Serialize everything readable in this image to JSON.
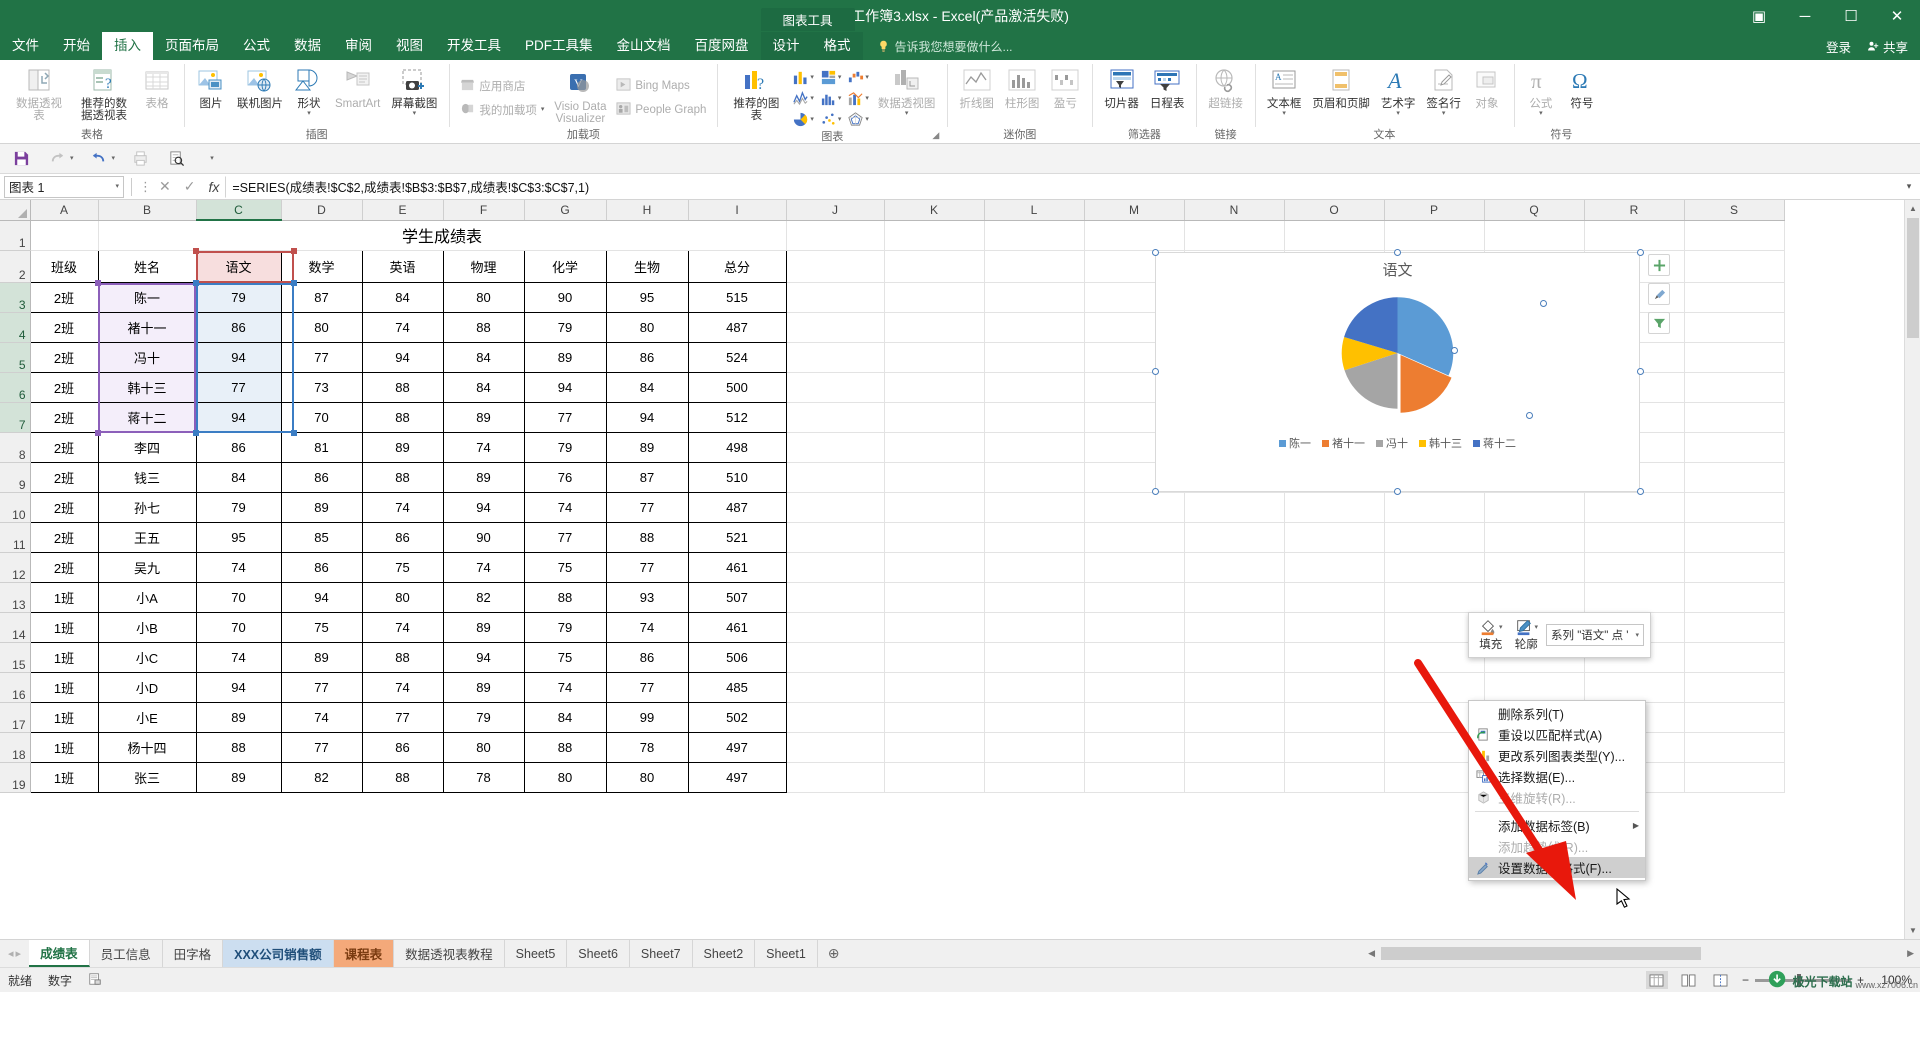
{
  "titlebar": {
    "title": "工作簿3.xlsx - Excel(产品激活失败)",
    "restore_icon": "▣",
    "minimize_icon": "─",
    "maximize_icon": "☐",
    "close_icon": "✕",
    "ribbon_display_icon": "⌃"
  },
  "tabs": [
    {
      "label": "文件",
      "active": false
    },
    {
      "label": "开始",
      "active": false
    },
    {
      "label": "插入",
      "active": true
    },
    {
      "label": "页面布局",
      "active": false
    },
    {
      "label": "公式",
      "active": false
    },
    {
      "label": "数据",
      "active": false
    },
    {
      "label": "审阅",
      "active": false
    },
    {
      "label": "视图",
      "active": false
    },
    {
      "label": "开发工具",
      "active": false
    },
    {
      "label": "PDF工具集",
      "active": false
    },
    {
      "label": "金山文档",
      "active": false
    },
    {
      "label": "百度网盘",
      "active": false
    }
  ],
  "contextual": {
    "group_title": "图表工具",
    "tabs": [
      {
        "label": "设计",
        "active": false
      },
      {
        "label": "格式",
        "active": false
      }
    ]
  },
  "tellme": {
    "placeholder": "告诉我您想要做什么..."
  },
  "account": {
    "signin": "登录",
    "share": "共享"
  },
  "ribbon": {
    "groups": [
      {
        "name": "表格",
        "label": "表格",
        "items": [
          {
            "label": "数据透视表",
            "icon": "pivot-table-icon",
            "disabled": true,
            "two_line": true
          },
          {
            "label": "推荐的数据透视表",
            "icon": "recommended-pivot-icon",
            "disabled": false,
            "two_line": true
          },
          {
            "label": "表格",
            "icon": "table-icon",
            "disabled": true,
            "two_line": false
          }
        ]
      },
      {
        "name": "插图",
        "label": "插图",
        "items": [
          {
            "label": "图片",
            "icon": "picture-icon",
            "disabled": false
          },
          {
            "label": "联机图片",
            "icon": "online-picture-icon",
            "disabled": false
          },
          {
            "label": "形状",
            "icon": "shapes-icon",
            "disabled": false,
            "caret": true
          },
          {
            "label": "SmartArt",
            "icon": "smartart-icon",
            "disabled": true
          },
          {
            "label": "屏幕截图",
            "icon": "screenshot-icon",
            "disabled": false,
            "caret": true
          }
        ]
      },
      {
        "name": "加载项",
        "label": "加载项",
        "small_items": [
          {
            "label": "应用商店",
            "icon": "store-icon",
            "disabled": true
          },
          {
            "label": "我的加载项",
            "icon": "my-addins-icon",
            "disabled": true,
            "caret": true
          },
          {
            "label": "Bing Maps",
            "icon": "bing-maps-icon",
            "disabled": true
          },
          {
            "label": "People Graph",
            "icon": "people-graph-icon",
            "disabled": true
          }
        ],
        "big_items": [
          {
            "label": "Visio Data Visualizer",
            "icon": "visio-data-visualizer-icon",
            "disabled": true
          }
        ]
      },
      {
        "name": "图表",
        "label": "图表",
        "recommended": {
          "label": "推荐的图表",
          "icon": "recommended-charts-icon"
        },
        "mini": [
          {
            "icon": "column-chart-icon"
          },
          {
            "icon": "hierarchy-chart-icon"
          },
          {
            "icon": "waterfall-chart-icon"
          },
          {
            "icon": "line-chart-icon"
          },
          {
            "icon": "statistic-chart-icon"
          },
          {
            "icon": "combo-chart-icon"
          },
          {
            "icon": "pie-chart-icon"
          },
          {
            "icon": "scatter-chart-icon"
          },
          {
            "icon": "radar-chart-icon"
          }
        ],
        "pivotchart": {
          "label": "数据透视图",
          "icon": "pivot-chart-icon",
          "disabled": true,
          "caret": true
        },
        "has_launcher": true
      },
      {
        "name": "迷你图",
        "label": "迷你图",
        "items": [
          {
            "label": "折线图",
            "icon": "sparkline-line-icon",
            "disabled": true
          },
          {
            "label": "柱形图",
            "icon": "sparkline-column-icon",
            "disabled": true
          },
          {
            "label": "盈亏",
            "icon": "sparkline-winloss-icon",
            "disabled": true
          }
        ]
      },
      {
        "name": "筛选器",
        "label": "筛选器",
        "items": [
          {
            "label": "切片器",
            "icon": "slicer-icon",
            "disabled": false
          },
          {
            "label": "日程表",
            "icon": "timeline-icon",
            "disabled": false
          }
        ]
      },
      {
        "name": "链接",
        "label": "链接",
        "items": [
          {
            "label": "超链接",
            "icon": "hyperlink-icon",
            "disabled": true
          }
        ]
      },
      {
        "name": "文本",
        "label": "文本",
        "items": [
          {
            "label": "文本框",
            "icon": "textbox-icon",
            "disabled": false,
            "caret": true
          },
          {
            "label": "页眉和页脚",
            "icon": "header-footer-icon",
            "disabled": false
          },
          {
            "label": "艺术字",
            "icon": "wordart-icon",
            "disabled": false,
            "caret": true
          },
          {
            "label": "签名行",
            "icon": "signature-line-icon",
            "disabled": false,
            "caret": true
          },
          {
            "label": "对象",
            "icon": "object-icon",
            "disabled": true
          }
        ]
      },
      {
        "name": "符号",
        "label": "符号",
        "items": [
          {
            "label": "公式",
            "icon": "equation-icon",
            "disabled": true,
            "caret": true
          },
          {
            "label": "符号",
            "icon": "symbol-icon",
            "disabled": false
          }
        ]
      }
    ]
  },
  "qat": {
    "buttons": [
      {
        "name": "save-button",
        "icon": "save-icon",
        "disabled": false
      },
      {
        "name": "redo-button",
        "icon": "redo-icon",
        "disabled": true
      },
      {
        "name": "undo-button",
        "icon": "undo-icon",
        "disabled": false
      },
      {
        "name": "quick-print-button",
        "icon": "quick-print-icon",
        "disabled": true
      },
      {
        "name": "print-preview-button",
        "icon": "print-preview-icon",
        "disabled": false
      },
      {
        "name": "customize-qat-button",
        "icon": "chevron-down-icon",
        "disabled": true
      }
    ]
  },
  "formulabar": {
    "namebox_value": "图表 1",
    "namebox_caret": "▾",
    "cancel_icon": "✕",
    "enter_icon": "✓",
    "fx_icon": "fx",
    "formula": "=SERIES(成绩表!$C$2,成绩表!$B$3:$B$7,成绩表!$C$3:$C$7,1)",
    "expand_icon": "▾"
  },
  "grid": {
    "columns": [
      "A",
      "B",
      "C",
      "D",
      "E",
      "F",
      "G",
      "H",
      "I",
      "J",
      "K",
      "L",
      "M",
      "N",
      "O",
      "P",
      "Q",
      "R",
      "S"
    ],
    "selected_column": "C",
    "rows": [
      1,
      2,
      3,
      4,
      5,
      6,
      7,
      8,
      9,
      10,
      11,
      12,
      13,
      14,
      15,
      16,
      17,
      18,
      19
    ],
    "selected_rows": [
      3,
      4,
      5,
      6,
      7
    ],
    "title_row": {
      "row": 1,
      "text": "学生成绩表"
    },
    "headers": [
      "班级",
      "姓名",
      "语文",
      "数学",
      "英语",
      "物理",
      "化学",
      "生物",
      "总分"
    ],
    "data": [
      {
        "row": 3,
        "cells": [
          "2班",
          "陈一",
          "79",
          "87",
          "84",
          "80",
          "90",
          "95",
          "515"
        ]
      },
      {
        "row": 4,
        "cells": [
          "2班",
          "褚十一",
          "86",
          "80",
          "74",
          "88",
          "79",
          "80",
          "487"
        ]
      },
      {
        "row": 5,
        "cells": [
          "2班",
          "冯十",
          "94",
          "77",
          "94",
          "84",
          "89",
          "86",
          "524"
        ]
      },
      {
        "row": 6,
        "cells": [
          "2班",
          "韩十三",
          "77",
          "73",
          "88",
          "84",
          "94",
          "84",
          "500"
        ]
      },
      {
        "row": 7,
        "cells": [
          "2班",
          "蒋十二",
          "94",
          "70",
          "88",
          "89",
          "77",
          "94",
          "512"
        ]
      },
      {
        "row": 8,
        "cells": [
          "2班",
          "李四",
          "86",
          "81",
          "89",
          "74",
          "79",
          "89",
          "498"
        ]
      },
      {
        "row": 9,
        "cells": [
          "2班",
          "钱三",
          "84",
          "86",
          "88",
          "89",
          "76",
          "87",
          "510"
        ]
      },
      {
        "row": 10,
        "cells": [
          "2班",
          "孙七",
          "79",
          "89",
          "74",
          "94",
          "74",
          "77",
          "487"
        ]
      },
      {
        "row": 11,
        "cells": [
          "2班",
          "王五",
          "95",
          "85",
          "86",
          "90",
          "77",
          "88",
          "521"
        ]
      },
      {
        "row": 12,
        "cells": [
          "2班",
          "吴九",
          "74",
          "86",
          "75",
          "74",
          "75",
          "77",
          "461"
        ]
      },
      {
        "row": 13,
        "cells": [
          "1班",
          "小A",
          "70",
          "94",
          "80",
          "82",
          "88",
          "93",
          "507"
        ]
      },
      {
        "row": 14,
        "cells": [
          "1班",
          "小B",
          "70",
          "75",
          "74",
          "89",
          "79",
          "74",
          "461"
        ]
      },
      {
        "row": 15,
        "cells": [
          "1班",
          "小C",
          "74",
          "89",
          "88",
          "94",
          "75",
          "86",
          "506"
        ]
      },
      {
        "row": 16,
        "cells": [
          "1班",
          "小D",
          "94",
          "77",
          "74",
          "89",
          "74",
          "77",
          "485"
        ]
      },
      {
        "row": 17,
        "cells": [
          "1班",
          "小E",
          "89",
          "74",
          "77",
          "79",
          "84",
          "99",
          "502"
        ]
      },
      {
        "row": 18,
        "cells": [
          "1班",
          "杨十四",
          "88",
          "77",
          "86",
          "80",
          "88",
          "78",
          "497"
        ]
      },
      {
        "row": 19,
        "cells": [
          "1班",
          "张三",
          "89",
          "82",
          "88",
          "78",
          "80",
          "80",
          "497"
        ]
      }
    ]
  },
  "chart_data": {
    "type": "pie",
    "title": "语文",
    "categories": [
      "陈一",
      "褚十一",
      "冯十",
      "韩十三",
      "蒋十二"
    ],
    "values": [
      79,
      86,
      94,
      77,
      94
    ],
    "colors": [
      "#5b9bd5",
      "#ed7d31",
      "#a5a5a5",
      "#ffc000",
      "#4472c4"
    ],
    "legend_position": "bottom",
    "legend_entries": [
      "陈一",
      "褚十一",
      "冯十",
      "韩十三",
      "蒋十二"
    ],
    "xlabel": "",
    "ylabel": "",
    "selected_point": "褚十一"
  },
  "chart_sidebuttons": [
    {
      "name": "chart-elements-button",
      "icon": "plus-icon"
    },
    {
      "name": "chart-styles-button",
      "icon": "brush-icon"
    },
    {
      "name": "chart-filters-button",
      "icon": "filter-icon"
    }
  ],
  "minitoolbar": {
    "fill": {
      "label": "填充",
      "icon": "fill-bucket-icon",
      "caret": "▾"
    },
    "outline": {
      "label": "轮廓",
      "icon": "outline-pen-icon",
      "caret": "▾"
    },
    "combo_value": "系列 \"语文\" 点 '",
    "combo_caret": "▾"
  },
  "contextmenu": {
    "items": [
      {
        "label": "删除系列(T)",
        "icon": "",
        "disabled": false,
        "highlight": false,
        "submenu": false
      },
      {
        "label": "重设以匹配样式(A)",
        "icon": "reset-style-icon",
        "disabled": false,
        "highlight": false,
        "submenu": false
      },
      {
        "label": "更改系列图表类型(Y)...",
        "icon": "change-chart-type-icon",
        "disabled": false,
        "highlight": false,
        "submenu": false
      },
      {
        "label": "选择数据(E)...",
        "icon": "select-data-icon",
        "disabled": false,
        "highlight": false,
        "submenu": false
      },
      {
        "label": "三维旋转(R)...",
        "icon": "3d-rotation-icon",
        "disabled": true,
        "highlight": false,
        "submenu": false
      },
      {
        "separator": true
      },
      {
        "label": "添加数据标签(B)",
        "icon": "",
        "disabled": false,
        "highlight": false,
        "submenu": true
      },
      {
        "label": "添加趋势线(R)...",
        "icon": "",
        "disabled": true,
        "highlight": false,
        "submenu": false
      },
      {
        "label": "设置数据点格式(F)...",
        "icon": "format-datapoint-icon",
        "disabled": false,
        "highlight": true,
        "submenu": false
      }
    ]
  },
  "sheettabs": {
    "nav": {
      "prev": "◂",
      "next": "▸"
    },
    "tabs": [
      {
        "label": "成绩表",
        "active": true,
        "color": ""
      },
      {
        "label": "员工信息",
        "active": false,
        "color": ""
      },
      {
        "label": "田字格",
        "active": false,
        "color": ""
      },
      {
        "label": "XXX公司销售额",
        "active": false,
        "color": "#ccdef0"
      },
      {
        "label": "课程表",
        "active": false,
        "color": "#f4a97a"
      },
      {
        "label": "数据透视表教程",
        "active": false,
        "color": ""
      },
      {
        "label": "Sheet5",
        "active": false,
        "color": ""
      },
      {
        "label": "Sheet6",
        "active": false,
        "color": ""
      },
      {
        "label": "Sheet7",
        "active": false,
        "color": ""
      },
      {
        "label": "Sheet2",
        "active": false,
        "color": ""
      },
      {
        "label": "Sheet1",
        "active": false,
        "color": ""
      }
    ],
    "add_label": "⊕"
  },
  "statusbar": {
    "mode": "就绪",
    "numlock": "数字",
    "macro_icon": "record-macro-icon",
    "views": [
      {
        "name": "normal-view-button",
        "icon": "normal-view-icon",
        "active": true
      },
      {
        "name": "page-layout-view-button",
        "icon": "page-layout-icon",
        "active": false
      },
      {
        "name": "page-break-view-button",
        "icon": "page-break-icon",
        "active": false
      }
    ],
    "zoom_out": "−",
    "zoom_in": "+",
    "zoom_level": "100%"
  },
  "watermark": {
    "text": "极光下载站",
    "sub": "www.xz7006.cn"
  }
}
